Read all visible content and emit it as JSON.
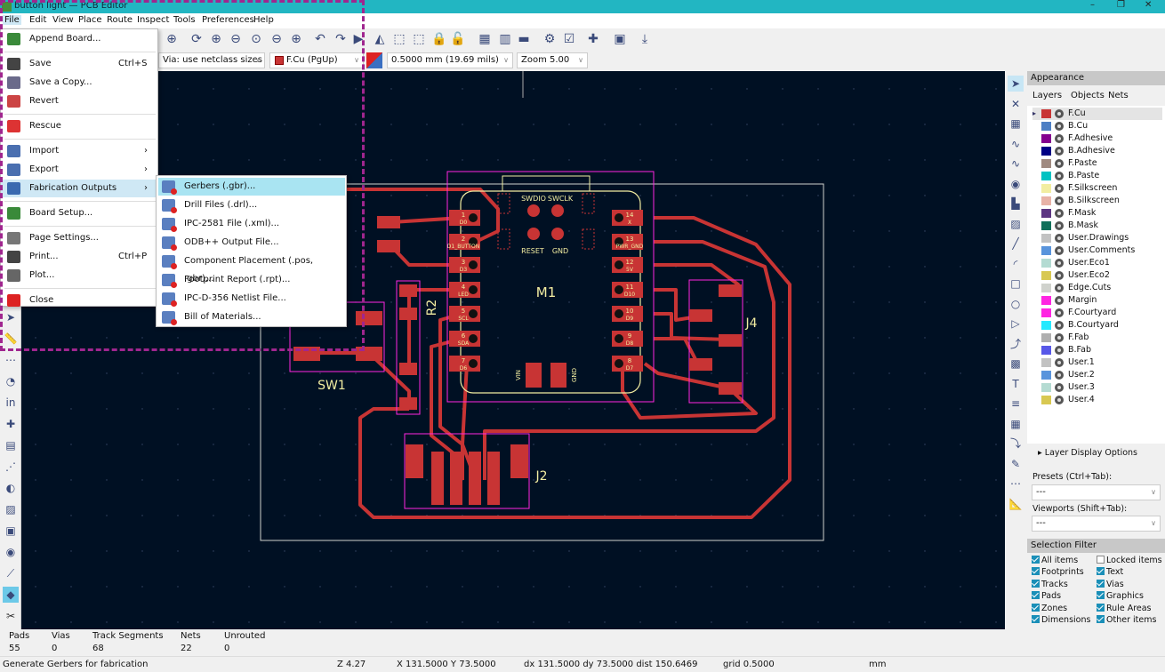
{
  "window": {
    "title": "button light — PCB Editor",
    "controls": [
      "–",
      "❐",
      "✕"
    ]
  },
  "menubar": [
    "File",
    "Edit",
    "View",
    "Place",
    "Route",
    "Inspect",
    "Tools",
    "Preferences",
    "Help"
  ],
  "toolbar": {
    "via_size": "Via: use netclass sizes",
    "layer": "F.Cu (PgUp)",
    "layer_color": "#c83434",
    "track_width": "0.5000 mm (19.69 mils)",
    "zoom": "Zoom 5.00"
  },
  "file_menu": [
    {
      "label": "Append Board...",
      "icon": "append-board-icon"
    },
    {
      "sep": true
    },
    {
      "label": "Save",
      "shortcut": "Ctrl+S",
      "icon": "save-icon"
    },
    {
      "label": "Save a Copy...",
      "icon": "save-copy-icon"
    },
    {
      "label": "Revert",
      "icon": "revert-icon"
    },
    {
      "sep": true
    },
    {
      "label": "Rescue",
      "icon": "rescue-icon"
    },
    {
      "sep": true
    },
    {
      "label": "Import",
      "submenu": true,
      "icon": "import-icon"
    },
    {
      "label": "Export",
      "submenu": true,
      "icon": "export-icon"
    },
    {
      "label": "Fabrication Outputs",
      "submenu": true,
      "highlighted": true,
      "icon": "fabrication-icon"
    },
    {
      "sep": true
    },
    {
      "label": "Board Setup...",
      "icon": "board-setup-icon"
    },
    {
      "sep": true
    },
    {
      "label": "Page Settings...",
      "icon": "page-settings-icon"
    },
    {
      "label": "Print...",
      "shortcut": "Ctrl+P",
      "icon": "print-icon"
    },
    {
      "label": "Plot...",
      "icon": "plot-icon"
    },
    {
      "sep": true
    },
    {
      "label": "Close",
      "icon": "close-icon"
    }
  ],
  "fabrication_submenu": [
    {
      "label": "Gerbers (.gbr)...",
      "highlighted": true
    },
    {
      "label": "Drill Files (.drl)..."
    },
    {
      "label": "IPC-2581 File (.xml)..."
    },
    {
      "label": "ODB++ Output File..."
    },
    {
      "label": "Component Placement (.pos, .gbr)..."
    },
    {
      "label": "Footprint Report (.rpt)..."
    },
    {
      "label": "IPC-D-356 Netlist File..."
    },
    {
      "label": "Bill of Materials..."
    }
  ],
  "pcb": {
    "refs": {
      "m1": "M1",
      "sw1": "SW1",
      "r2": "R2",
      "j4": "J4",
      "j2": "J2"
    },
    "module_labels": {
      "swdio": "SWDIO",
      "swclk": "SWCLK",
      "reset": "RESET",
      "gnd": "GND",
      "vin": "VIN",
      "gnd2": "GND"
    },
    "left_pins": [
      {
        "n": "1",
        "net": "D0"
      },
      {
        "n": "2",
        "net": "D1_BUTTON"
      },
      {
        "n": "3",
        "net": "D3"
      },
      {
        "n": "4",
        "net": "LED"
      },
      {
        "n": "5",
        "net": "SCL"
      },
      {
        "n": "6",
        "net": "SDA"
      },
      {
        "n": "7",
        "net": "D6"
      }
    ],
    "right_pins": [
      {
        "n": "14",
        "net": "X"
      },
      {
        "n": "13",
        "net": "PWR_GND"
      },
      {
        "n": "12",
        "net": "5V"
      },
      {
        "n": "11",
        "net": "D10"
      },
      {
        "n": "10",
        "net": "D9"
      },
      {
        "n": "9",
        "net": "D8"
      },
      {
        "n": "8",
        "net": "D7"
      }
    ],
    "colors": {
      "background": "#001023",
      "copper": "#c83434",
      "edge": "#d0d2cd",
      "courtyard": "#ff26e2",
      "silk": "#f2eda1"
    }
  },
  "appearance": {
    "title": "Appearance",
    "tabs": [
      "Layers",
      "Objects",
      "Nets"
    ],
    "layers": [
      {
        "name": "F.Cu",
        "color": "#c83434",
        "active": true
      },
      {
        "name": "B.Cu",
        "color": "#4d7fc4"
      },
      {
        "name": "F.Adhesive",
        "color": "#84008f"
      },
      {
        "name": "B.Adhesive",
        "color": "#000084"
      },
      {
        "name": "F.Paste",
        "color": "#a08a80"
      },
      {
        "name": "B.Paste",
        "color": "#00c2c2"
      },
      {
        "name": "F.Silkscreen",
        "color": "#f2eda1"
      },
      {
        "name": "B.Silkscreen",
        "color": "#e8b2a7"
      },
      {
        "name": "F.Mask",
        "color": "#5c3582"
      },
      {
        "name": "B.Mask",
        "color": "#10705a"
      },
      {
        "name": "User.Drawings",
        "color": "#c2c2c2"
      },
      {
        "name": "User.Comments",
        "color": "#5994dc"
      },
      {
        "name": "User.Eco1",
        "color": "#b4dbd2"
      },
      {
        "name": "User.Eco2",
        "color": "#d8c852"
      },
      {
        "name": "Edge.Cuts",
        "color": "#d0d2cd"
      },
      {
        "name": "Margin",
        "color": "#ff26e2"
      },
      {
        "name": "F.Courtyard",
        "color": "#ff26e2"
      },
      {
        "name": "B.Courtyard",
        "color": "#26e9ff"
      },
      {
        "name": "F.Fab",
        "color": "#afafaf"
      },
      {
        "name": "B.Fab",
        "color": "#5858e8"
      },
      {
        "name": "User.1",
        "color": "#c2c2c2"
      },
      {
        "name": "User.2",
        "color": "#5994dc"
      },
      {
        "name": "User.3",
        "color": "#b4dbd2"
      },
      {
        "name": "User.4",
        "color": "#d8c852"
      }
    ],
    "layer_display_options": "Layer Display Options",
    "presets_label": "Presets (Ctrl+Tab):",
    "presets_value": "---",
    "viewports_label": "Viewports (Shift+Tab):",
    "viewports_value": "---"
  },
  "selection_filter": {
    "title": "Selection Filter",
    "items": [
      {
        "label": "All items",
        "checked": true
      },
      {
        "label": "Locked items",
        "checked": false
      },
      {
        "label": "Footprints",
        "checked": true
      },
      {
        "label": "Text",
        "checked": true
      },
      {
        "label": "Tracks",
        "checked": true
      },
      {
        "label": "Vias",
        "checked": true
      },
      {
        "label": "Pads",
        "checked": true
      },
      {
        "label": "Graphics",
        "checked": true
      },
      {
        "label": "Zones",
        "checked": true
      },
      {
        "label": "Rule Areas",
        "checked": true
      },
      {
        "label": "Dimensions",
        "checked": true
      },
      {
        "label": "Other items",
        "checked": true
      }
    ]
  },
  "stats": [
    {
      "label": "Pads",
      "value": "55"
    },
    {
      "label": "Vias",
      "value": "0"
    },
    {
      "label": "Track Segments",
      "value": "68"
    },
    {
      "label": "Nets",
      "value": "22"
    },
    {
      "label": "Unrouted",
      "value": "0"
    }
  ],
  "status": {
    "message": "Generate Gerbers for fabrication",
    "zoom": "Z 4.27",
    "xy": "X 131.5000  Y 73.5000",
    "delta": "dx 131.5000  dy 73.5000  dist 150.6469",
    "grid": "grid 0.5000",
    "units": "mm"
  }
}
